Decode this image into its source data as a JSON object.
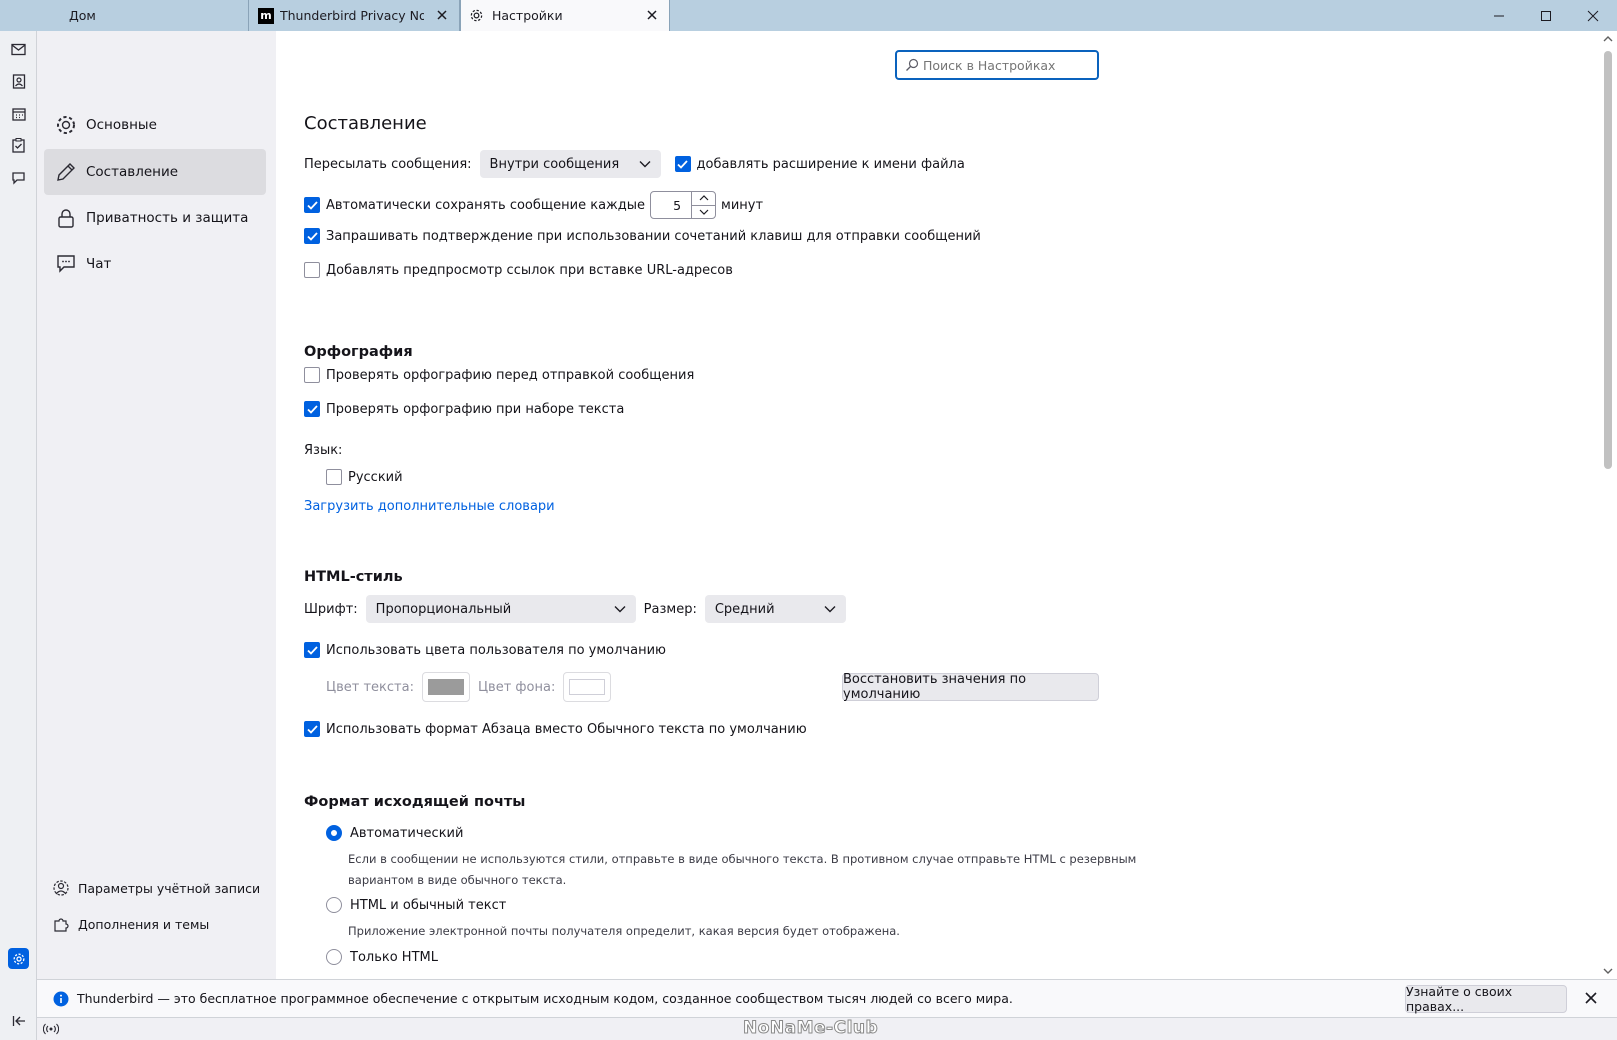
{
  "tabs": [
    {
      "label": "Дом"
    },
    {
      "label": "Thunderbird Privacy Notice"
    },
    {
      "label": "Настройки"
    }
  ],
  "sidebar": {
    "categories": [
      {
        "label": "Основные",
        "icon": "gear-icon"
      },
      {
        "label": "Составление",
        "icon": "pencil-icon"
      },
      {
        "label": "Приватность и защита",
        "icon": "lock-icon"
      },
      {
        "label": "Чат",
        "icon": "chat-icon"
      }
    ],
    "footer": [
      {
        "label": "Параметры учётной записи",
        "icon": "account-settings-icon"
      },
      {
        "label": "Дополнения и темы",
        "icon": "puzzle-icon"
      }
    ]
  },
  "search": {
    "placeholder": "Поиск в Настройках"
  },
  "composition": {
    "title": "Составление",
    "forward_label": "Пересылать сообщения:",
    "forward_value": "Внутри сообщения",
    "add_extension_label": "добавлять расширение к имени файла",
    "autosave_label": "Автоматически сохранять сообщение каждые",
    "autosave_value": "5",
    "autosave_unit": "минут",
    "confirm_shortcut_label": "Запрашивать подтверждение при использовании сочетаний клавиш для отправки сообщений",
    "link_preview_label": "Добавлять предпросмотр ссылок при вставке URL-адресов"
  },
  "spelling": {
    "title": "Орфография",
    "check_before_send": "Проверять орфографию перед отправкой сообщения",
    "check_while_typing": "Проверять орфографию при наборе текста",
    "language_label": "Язык:",
    "language_option": "Русский",
    "download_link": "Загрузить дополнительные словари"
  },
  "html_style": {
    "title": "HTML-стиль",
    "font_label": "Шрифт:",
    "font_value": "Пропорциональный",
    "size_label": "Размер:",
    "size_value": "Средний",
    "use_default_colors": "Использовать цвета пользователя по умолчанию",
    "text_color_label": "Цвет текста:",
    "bg_color_label": "Цвет фона:",
    "text_color": "#9b9b9b",
    "bg_color": "#ffffff",
    "restore_button": "Восстановить значения по умолчанию",
    "paragraph_format": "Использовать формат Абзаца вместо Обычного текста по умолчанию"
  },
  "outgoing": {
    "title": "Формат исходящей почты",
    "auto_label": "Автоматический",
    "auto_desc_1": "Если в сообщении не используются стили, отправьте в виде обычного текста. В противном случае отправьте HTML с резервным",
    "auto_desc_2": "вариантом в виде обычного текста.",
    "both_label": "HTML и обычный текст",
    "both_desc": "Приложение электронной почты получателя определит, какая версия будет отображена.",
    "html_only_label": "Только HTML"
  },
  "notification": {
    "text": "Thunderbird — это бесплатное программное обеспечение с открытым исходным кодом, созданное сообществом тысяч людей со всего мира.",
    "button": "Узнайте о своих правах..."
  },
  "watermark": "NoNaMe-Club",
  "colors": {
    "accent": "#0061e0",
    "titlebar": "#b8cfe0"
  }
}
